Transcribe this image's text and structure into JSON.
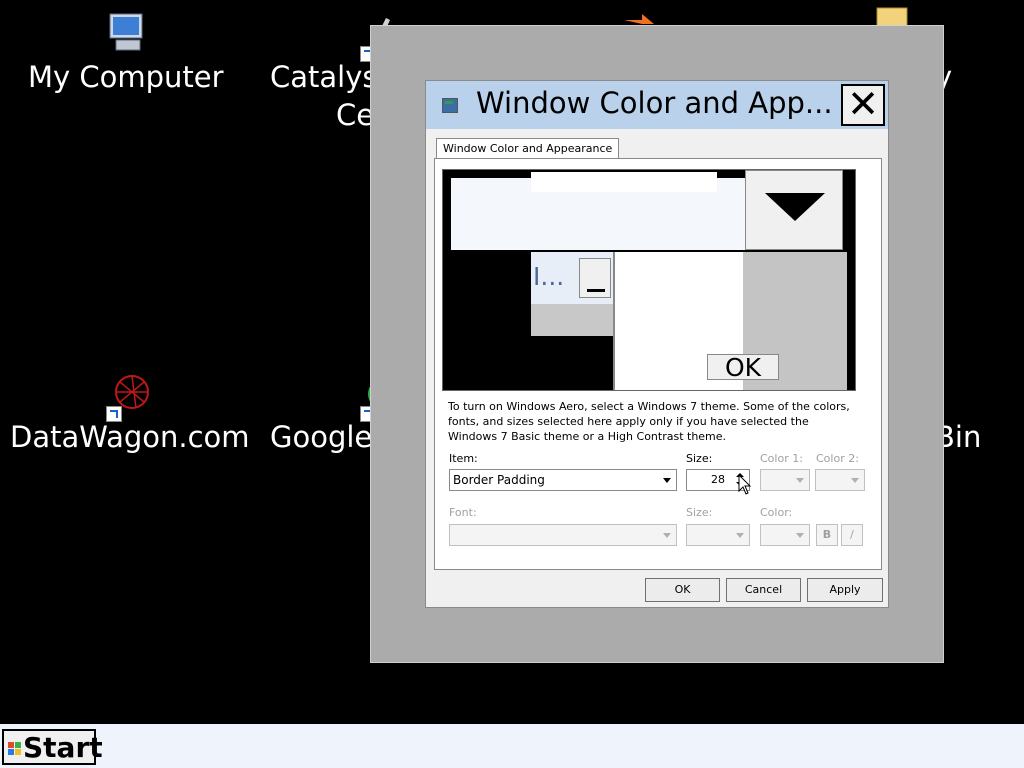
{
  "desktop": {
    "icons": [
      {
        "id": "my-computer",
        "label": "My Computer"
      },
      {
        "id": "catalyst",
        "label": "Catalys",
        "label2": "Ce"
      },
      {
        "id": "datawagon",
        "label": "DataWagon.com"
      },
      {
        "id": "google",
        "label": "Google"
      },
      {
        "id": "partial-right-top",
        "label": "y",
        "label2": ")"
      },
      {
        "id": "recycle",
        "label": "Bin"
      }
    ]
  },
  "dialog": {
    "title": "Window Color and App...",
    "close_glyph": "✕",
    "tab_label": "Window Color and Appearance",
    "preview": {
      "inactive_title": "I...",
      "ok_label": "OK"
    },
    "description": "To turn on Windows Aero, select a Windows 7 theme.  Some of the colors, fonts, and sizes selected here apply only if you have selected the Windows 7 Basic theme or a High Contrast theme.",
    "labels": {
      "item": "Item:",
      "size": "Size:",
      "color1": "Color 1:",
      "color2": "Color 2:",
      "font": "Font:",
      "font_size": "Size:",
      "color": "Color:"
    },
    "item_value": "Border Padding",
    "size_value": "28",
    "bold_label": "B",
    "italic_label": "/",
    "buttons": {
      "ok": "OK",
      "cancel": "Cancel",
      "apply": "Apply"
    }
  },
  "taskbar": {
    "start_label": "Start"
  }
}
